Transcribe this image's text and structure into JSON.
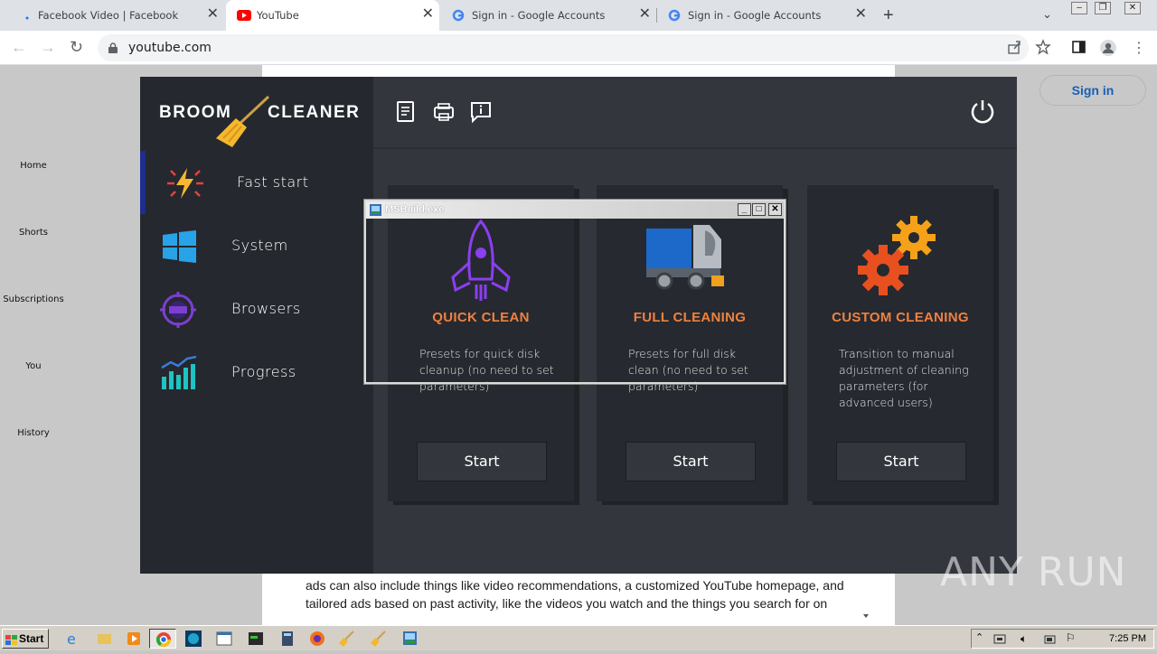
{
  "browser": {
    "tabs": [
      {
        "label": "Facebook Video | Facebook",
        "active": false
      },
      {
        "label": "YouTube",
        "active": true
      },
      {
        "label": "Sign in - Google Accounts",
        "active": false
      },
      {
        "label": "Sign in - Google Accounts",
        "active": false
      }
    ],
    "new_tab": "+",
    "url": "youtube.com"
  },
  "youtube": {
    "sidebar": [
      "Home",
      "Shorts",
      "Subscriptions",
      "You",
      "History"
    ],
    "sign_in": "Sign in",
    "consent_text": "ads can also include things like video recommendations, a customized YouTube homepage, and tailored ads based on past activity, like the videos you watch and the things you search for on"
  },
  "app": {
    "logo_left": "BROOM",
    "logo_right": "CLEANER",
    "menu": [
      {
        "label": "Fast start",
        "icon": "lightning-icon",
        "active": true
      },
      {
        "label": "System",
        "icon": "windows-icon",
        "active": false
      },
      {
        "label": "Browsers",
        "icon": "browser-target-icon",
        "active": false
      },
      {
        "label": "Progress",
        "icon": "progress-chart-icon",
        "active": false
      }
    ],
    "top_icons": [
      "report-icon",
      "printer-icon",
      "info-icon",
      "power-icon"
    ],
    "cards": [
      {
        "title": "QUICK CLEAN",
        "desc": "Presets for quick disk cleanup (no need to set parameters)",
        "button": "Start",
        "icon": "rocket-icon"
      },
      {
        "title": "FULL CLEANING",
        "desc": "Presets for full disk clean (no need to set parameters)",
        "button": "Start",
        "icon": "truck-icon"
      },
      {
        "title": "CUSTOM CLEANING",
        "desc": "Transition to manual adjustment of cleaning parameters (for advanced users)",
        "button": "Start",
        "icon": "gears-icon"
      }
    ],
    "accent": "#f0813f"
  },
  "dialog": {
    "title": "MSBuild.exe"
  },
  "watermark": "ANY RUN",
  "taskbar": {
    "start": "Start",
    "time": "7:25 PM"
  }
}
